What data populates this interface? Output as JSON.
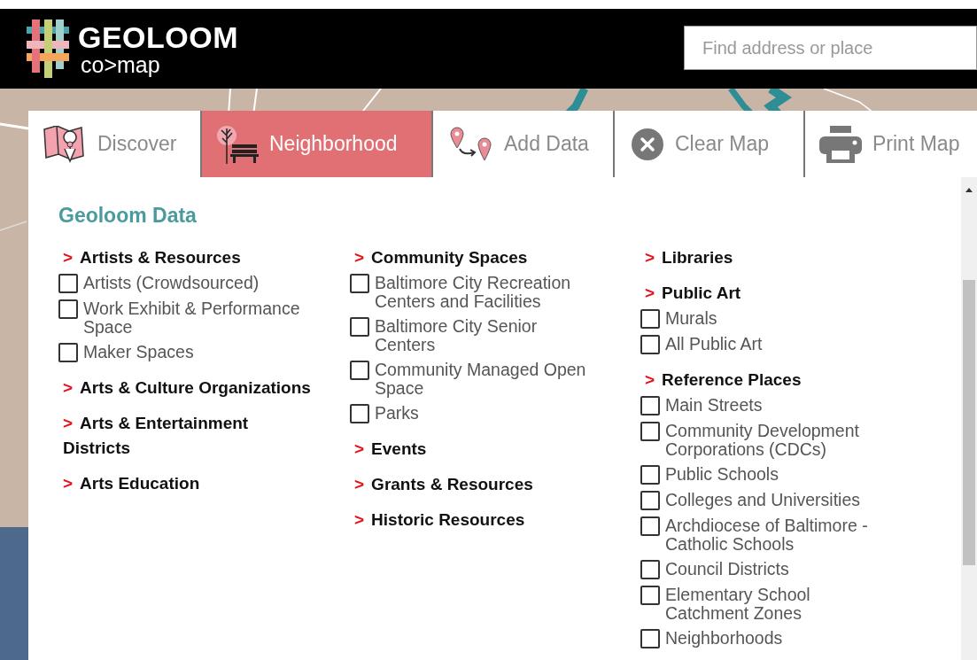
{
  "header": {
    "logo": {
      "title": "GEOLOOM",
      "subtitle": "co>map"
    },
    "search": {
      "placeholder": "Find address or place"
    }
  },
  "tabs": [
    {
      "label": "Discover",
      "kind": "map",
      "selected": false
    },
    {
      "label": "Neighborhood",
      "kind": "bench",
      "selected": true
    },
    {
      "label": "Add Data",
      "kind": "pins",
      "selected": false
    },
    {
      "label": "Clear Map",
      "kind": "clear",
      "selected": false
    },
    {
      "label": "Print Map",
      "kind": "print",
      "selected": false
    }
  ],
  "panel": {
    "title": "Geoloom Data",
    "columns": [
      [
        {
          "kind": "heading",
          "marker": ">",
          "label": "Artists & Resources"
        },
        {
          "kind": "checkbox",
          "label": "Artists (Crowdsourced)",
          "checked": false
        },
        {
          "kind": "checkbox",
          "label": "Work Exhibit & Performance Space",
          "checked": false
        },
        {
          "kind": "checkbox",
          "label": "Maker Spaces",
          "checked": false
        },
        {
          "kind": "heading",
          "marker": ">",
          "label": "Arts & Culture Organizations"
        },
        {
          "kind": "heading",
          "marker": ">",
          "label": "Arts & Entertainment Districts"
        },
        {
          "kind": "heading",
          "marker": ">",
          "label": "Arts Education"
        }
      ],
      [
        {
          "kind": "heading",
          "marker": ">",
          "label": "Community Spaces"
        },
        {
          "kind": "checkbox",
          "label": "Baltimore City Recreation Centers and Facilities",
          "checked": false
        },
        {
          "kind": "checkbox",
          "label": "Baltimore City Senior Centers",
          "checked": false
        },
        {
          "kind": "checkbox",
          "label": "Community Managed Open Space",
          "checked": false
        },
        {
          "kind": "checkbox",
          "label": "Parks",
          "checked": false
        },
        {
          "kind": "heading",
          "marker": ">",
          "label": "Events"
        },
        {
          "kind": "heading",
          "marker": ">",
          "label": "Grants & Resources"
        },
        {
          "kind": "heading",
          "marker": ">",
          "label": "Historic Resources"
        }
      ],
      [
        {
          "kind": "heading",
          "marker": ">",
          "label": "Libraries"
        },
        {
          "kind": "heading",
          "marker": ">",
          "label": "Public Art"
        },
        {
          "kind": "checkbox",
          "label": "Murals",
          "checked": false
        },
        {
          "kind": "checkbox",
          "label": "All Public Art",
          "checked": false
        },
        {
          "kind": "heading",
          "marker": ">",
          "label": "Reference Places"
        },
        {
          "kind": "checkbox",
          "label": "Main Streets",
          "checked": false
        },
        {
          "kind": "checkbox",
          "label": "Community Development Corporations (CDCs)",
          "checked": false
        },
        {
          "kind": "checkbox",
          "label": "Public Schools",
          "checked": false
        },
        {
          "kind": "checkbox",
          "label": "Colleges and Universities",
          "checked": false
        },
        {
          "kind": "checkbox",
          "label": "Archdiocese of Baltimore - Catholic Schools",
          "checked": false
        },
        {
          "kind": "checkbox",
          "label": "Council Districts",
          "checked": false
        },
        {
          "kind": "checkbox",
          "label": "Elementary School Catchment Zones",
          "checked": false
        },
        {
          "kind": "checkbox",
          "label": "Neighborhoods",
          "checked": false
        }
      ]
    ]
  }
}
